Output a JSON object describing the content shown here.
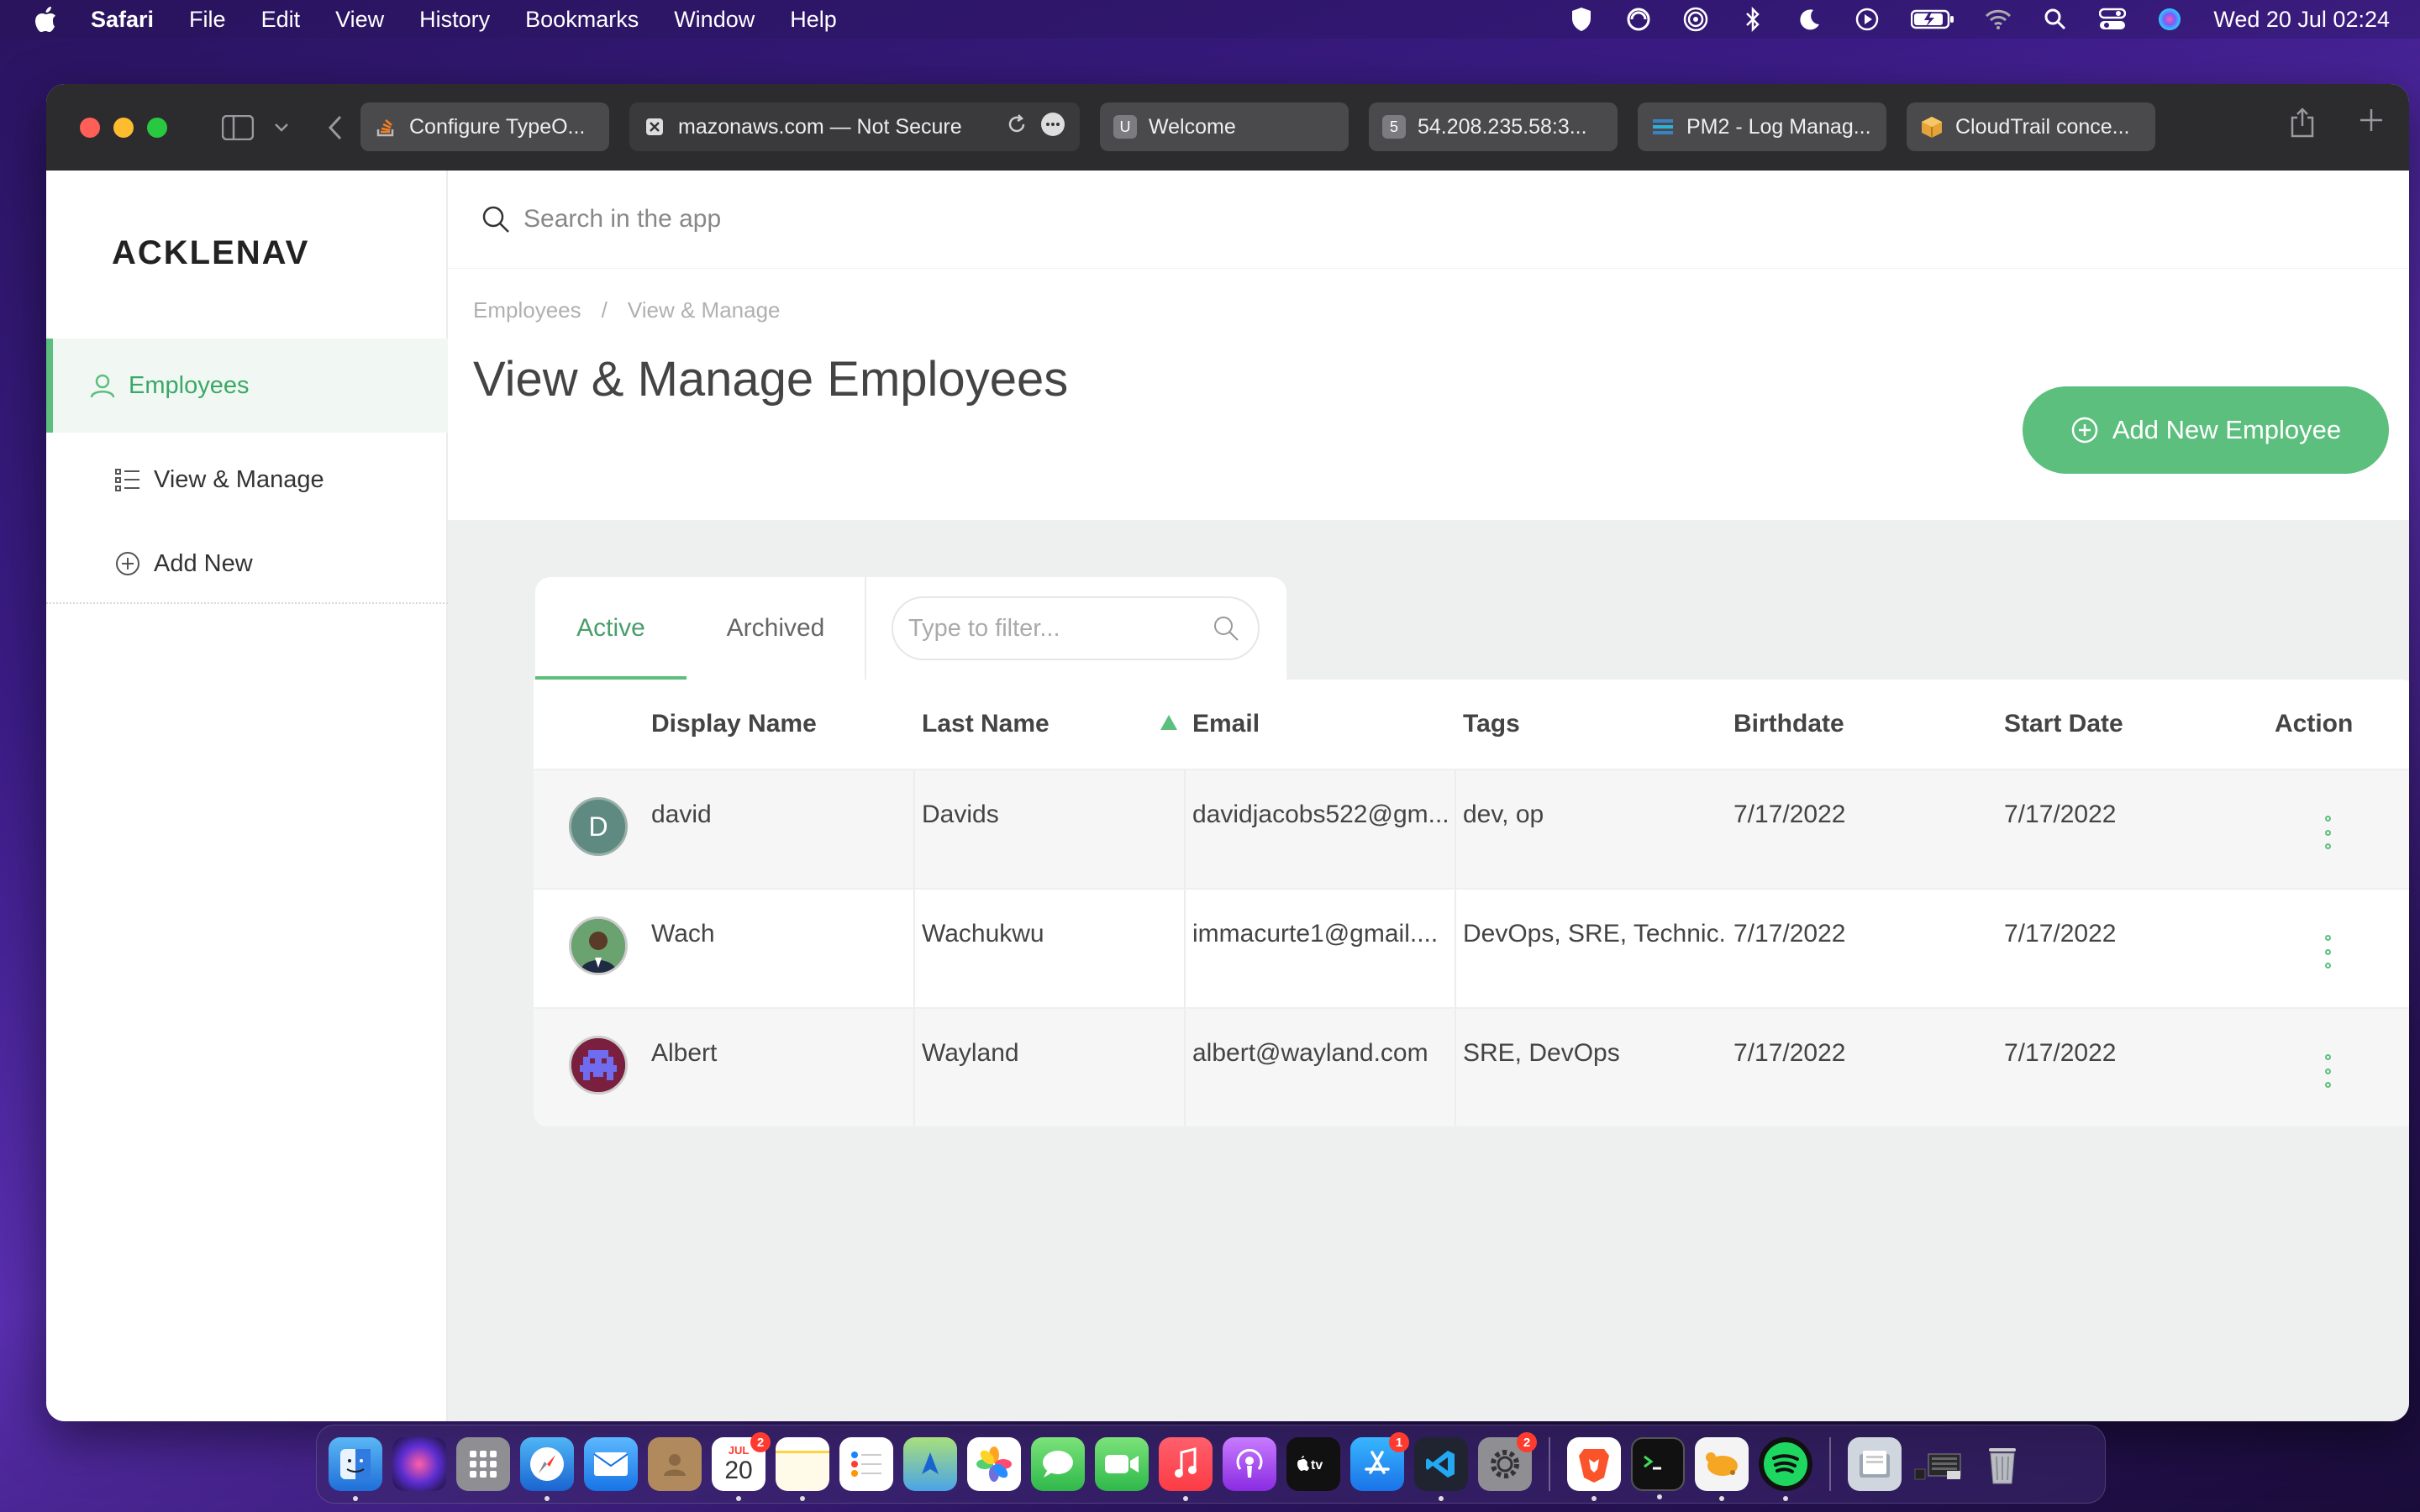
{
  "menubar": {
    "app": "Safari",
    "items": [
      "File",
      "Edit",
      "View",
      "History",
      "Bookmarks",
      "Window",
      "Help"
    ],
    "clock": "Wed 20 Jul  02:24"
  },
  "browser": {
    "tabs": [
      {
        "label": "Configure TypeO...",
        "icon": "stackoverflow-icon",
        "color": "#f48024"
      },
      {
        "label": "mazonaws.com — Not Secure",
        "icon": "close-icon",
        "color": "#666666"
      },
      {
        "label": "Welcome",
        "icon": "u-icon",
        "color": "#7c7c80",
        "fav_text": "U"
      },
      {
        "label": "54.208.235.58:3...",
        "icon": "five-icon",
        "color": "#7c7c80",
        "fav_text": "5"
      },
      {
        "label": "PM2 - Log Manag...",
        "icon": "pm2-icon",
        "color": "#3b82c4"
      },
      {
        "label": "CloudTrail conce...",
        "icon": "aws-box-icon",
        "color": "#e4a43a"
      }
    ]
  },
  "app": {
    "logo": "ACKLENAV",
    "search_placeholder": "Search in the app",
    "sidebar": [
      {
        "label": "Employees",
        "icon": "user-icon",
        "active": true
      },
      {
        "label": "View & Manage",
        "icon": "list-icon",
        "active": false
      },
      {
        "label": "Add New",
        "icon": "plus-circle-icon",
        "active": false
      }
    ],
    "breadcrumb": [
      "Employees",
      "/",
      "View & Manage"
    ],
    "title": "View & Manage Employees",
    "add_button": "Add New Employee",
    "tabs": [
      "Active",
      "Archived"
    ],
    "filter_placeholder": "Type to filter...",
    "columns": [
      "Display Name",
      "Last Name",
      "Email",
      "Tags",
      "Birthdate",
      "Start Date",
      "Action"
    ],
    "rows": [
      {
        "display_name": "david",
        "last_name": "Davids",
        "email": "davidjacobs522@gm...",
        "tags": "dev, op",
        "birthdate": "7/17/2022",
        "start_date": "7/17/2022",
        "avatar": "D"
      },
      {
        "display_name": "Wach",
        "last_name": "Wachukwu",
        "email": "immacurte1@gmail....",
        "tags": "DevOps, SRE, Technic...",
        "birthdate": "7/17/2022",
        "start_date": "7/17/2022",
        "avatar": ""
      },
      {
        "display_name": "Albert",
        "last_name": "Wayland",
        "email": "albert@wayland.com",
        "tags": "SRE, DevOps",
        "birthdate": "7/17/2022",
        "start_date": "7/17/2022",
        "avatar": ""
      }
    ],
    "colors": {
      "accent": "#5cbf7e",
      "accent_text": "#3aa866"
    }
  },
  "dock": {
    "calendar_month": "JUL",
    "calendar_day": "20",
    "badges": {
      "calendar": "2",
      "appstore": "1",
      "settings": "2"
    }
  }
}
